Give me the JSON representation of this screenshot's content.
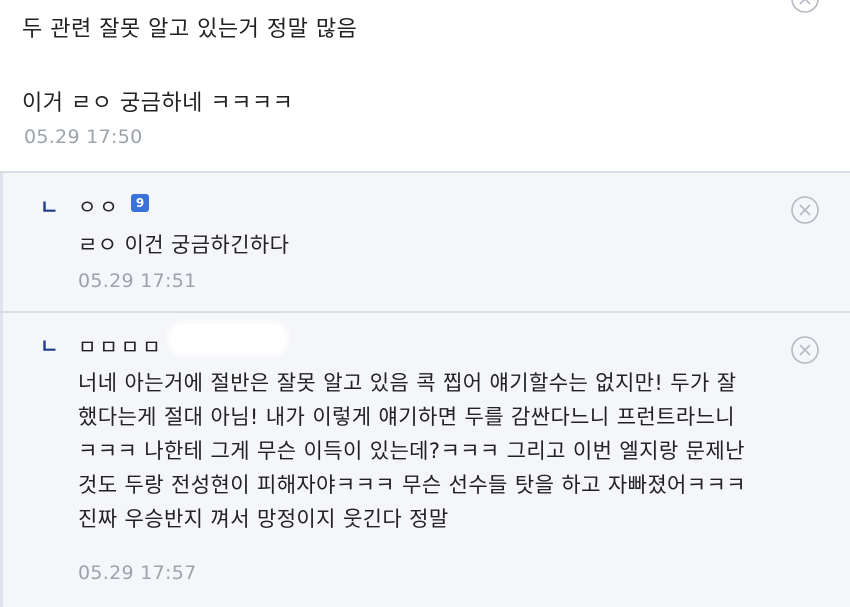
{
  "main_comment": {
    "line1": "두 관련 잘못 알고 있는거 정말 많음",
    "line2": "이거 ㄹㅇ 궁금하네 ㅋㅋㅋㅋ",
    "time": "05.29 17:50"
  },
  "replies": [
    {
      "marker": "ㄴ",
      "author": "ㅇㅇ",
      "badge": "9",
      "text": [
        "ㄹㅇ 이건 궁금하긴하다"
      ],
      "time": "05.29 17:51",
      "close_icon": "circle-x-icon"
    },
    {
      "marker": "ㄴ",
      "author": "ㅁㅁㅁㅁ",
      "text": [
        "너네 아는거에 절반은 잘못 알고 있음 콕 찝어 얘기할수는 없지만! 두가 잘",
        "했다는게 절대 아님! 내가 이렇게 얘기하면 두를 감싼다느니 프런트라느니",
        "ㅋㅋㅋ 나한테 그게 무슨 이득이 있는데?ㅋㅋㅋ 그리고 이번 엘지랑 문제난",
        "것도 두랑 전성현이 피해자야ㅋㅋㅋ 무슨 선수들 탓을 하고 자빠졌어ㅋㅋㅋ",
        "진짜 우승반지 껴서 망정이지 웃긴다 정말"
      ],
      "time": "05.29 17:57",
      "close_icon": "circle-x-icon"
    }
  ],
  "colors": {
    "reply_bg": "#f5f6fa",
    "separator": "#d9dde6",
    "timestamp": "#9ca3ab",
    "reply_marker": "#1f3e88",
    "badge": "#3a73d8"
  }
}
